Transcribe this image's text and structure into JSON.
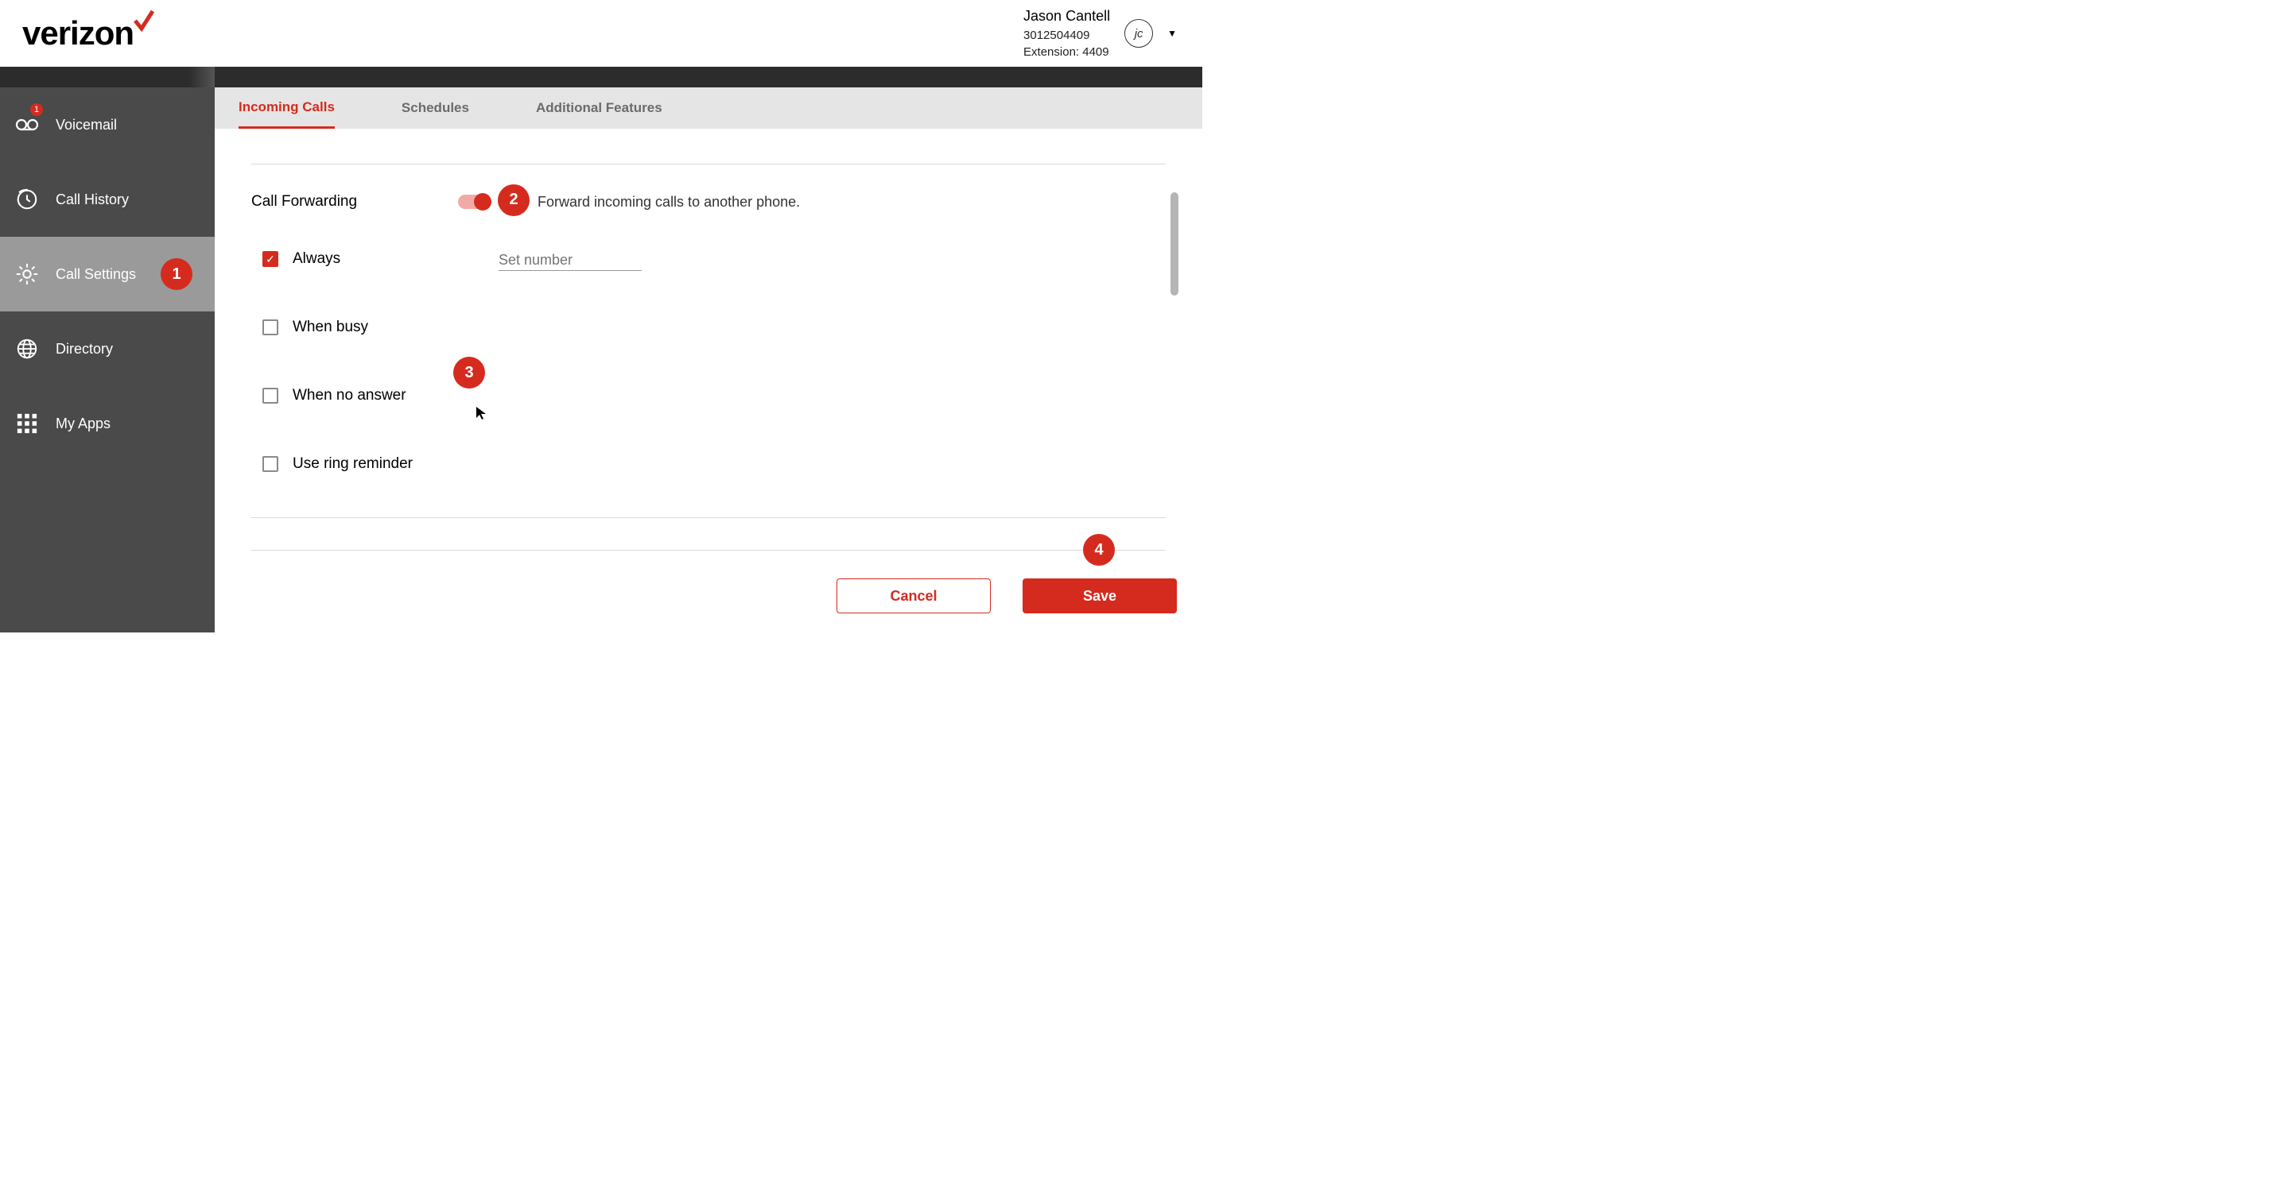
{
  "brand": {
    "name": "verizon"
  },
  "user": {
    "name": "Jason Cantell",
    "id": "3012504409",
    "extension_label": "Extension: 4409",
    "initials": "jc"
  },
  "sidebar": {
    "voicemail_badge": "1",
    "items": [
      {
        "label": "Voicemail"
      },
      {
        "label": "Call History"
      },
      {
        "label": "Call Settings"
      },
      {
        "label": "Directory"
      },
      {
        "label": "My Apps"
      }
    ]
  },
  "tabs": [
    {
      "label": "Incoming Calls"
    },
    {
      "label": "Schedules"
    },
    {
      "label": "Additional Features"
    }
  ],
  "section": {
    "title": "Call Forwarding",
    "description": "Forward incoming calls to another phone.",
    "set_number_placeholder": "Set number",
    "options": {
      "always": "Always",
      "when_busy": "When busy",
      "when_no_answer": "When no answer",
      "ring_reminder": "Use ring reminder"
    }
  },
  "buttons": {
    "cancel": "Cancel",
    "save": "Save"
  },
  "annotations": {
    "a1": "1",
    "a2": "2",
    "a3": "3",
    "a4": "4"
  }
}
